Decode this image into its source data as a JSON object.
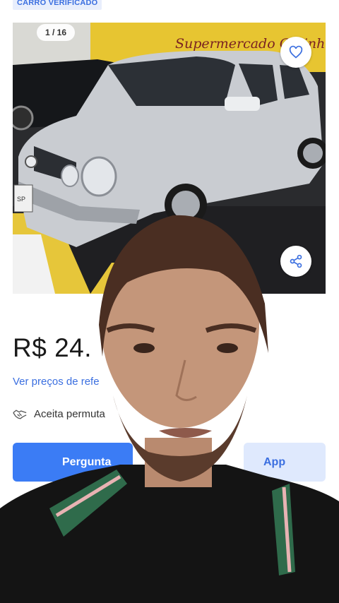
{
  "badge": {
    "label": "CARRO VERIFICADO"
  },
  "gallery": {
    "counter": "1 / 16",
    "shop_sign": "Supermercado Gatinhas",
    "plate_text": "SP"
  },
  "listing": {
    "price": "R$ 24.",
    "reference_link": "Ver preços de refe",
    "exchange_label": "Aceita permuta"
  },
  "actions": {
    "ask_label": "Pergunta",
    "chat_label": "App"
  },
  "colors": {
    "accent": "#3b7cf5",
    "link": "#3b6fe0",
    "secondary_bg": "#dfe9fd"
  },
  "icons": [
    "heart-icon",
    "share-icon",
    "handshake-icon"
  ]
}
